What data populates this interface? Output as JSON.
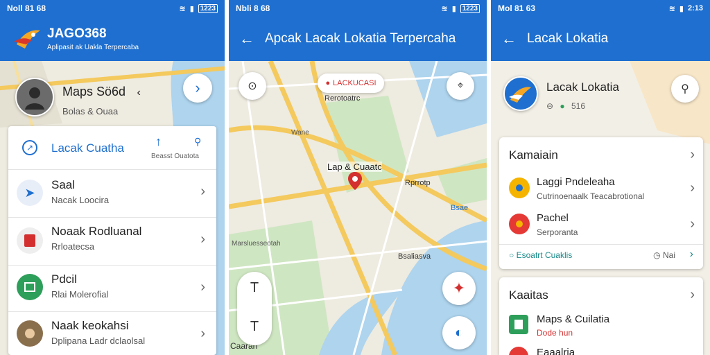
{
  "status": {
    "p1_left": "Noll 81 68",
    "p1_right": "1223",
    "p2_left": "Nbli 8 68",
    "p2_right": "1223",
    "p3_left": "Mol 81 63",
    "p3_right": "2:13"
  },
  "screen1": {
    "app_name": "JAGO368",
    "app_tagline": "Aplipasit ak Uakla Terpercaba",
    "profile_name": "Maps Sö6d",
    "profile_caret": "‹",
    "profile_sub": "Bolas & Ouaa",
    "search_label": "Lacak Cuatha",
    "search_action": "Beasst Ouatota",
    "items": [
      {
        "title": "Saal",
        "subtitle": "Nacak Loocira"
      },
      {
        "title": "Noaak Rodluanal",
        "subtitle": "Rrloatecsa"
      },
      {
        "title": "Pdcil",
        "subtitle": "Rlai Molerofial"
      },
      {
        "title": "Naak keokahsi",
        "subtitle": "Dplipana Ladr dclaolsal"
      }
    ]
  },
  "screen2": {
    "title": "Apcak Lacak Lokatia Terpercaha",
    "pin_callout": "LACKUCASI",
    "map_labels": {
      "top": "Rerotoatrc",
      "center": "Lap & Cuaatc",
      "right": "Rprrotp",
      "mid_right": "Bsae",
      "bottom_center": "Bsaliasva",
      "left_vertical": "Marsluesseotah",
      "small": "Wane",
      "bottom_left": "Caarah"
    },
    "zoom_in": "T",
    "zoom_out": "T"
  },
  "screen3": {
    "title": "Lacak Lokatia",
    "header_name": "Lacak Lokatia",
    "header_meta": "516",
    "card1": {
      "title": "Kamaiain",
      "items": [
        {
          "title": "Laggi Pndeleaha",
          "subtitle": "Cutrinoenaalk Teacabrotional"
        },
        {
          "title": "Pachel",
          "subtitle": "Serporanta"
        }
      ],
      "footer_left": "Esoatrt Cuaklis",
      "footer_right": "Nai"
    },
    "card2": {
      "title": "Kaaitas",
      "items": [
        {
          "title": "Maps & Cuilatia",
          "subtitle": "Dode hun"
        },
        {
          "title": "Eaaalria",
          "subtitle": ""
        }
      ]
    }
  },
  "colors": {
    "primary": "#1e6fcf",
    "map_land": "#eeebe0",
    "map_water": "#aed4ee",
    "map_park": "#cfe6c2",
    "road": "#f4c95d",
    "pin": "#d32f2f"
  }
}
